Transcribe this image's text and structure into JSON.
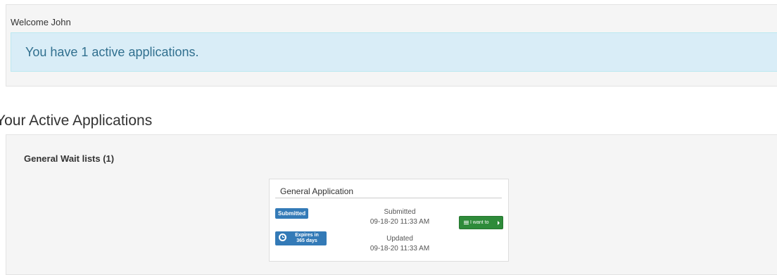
{
  "welcome": {
    "greeting": "Welcome John",
    "alert_message": "You have 1 active applications."
  },
  "active_applications": {
    "heading": "Your Active Applications",
    "group_title": "General Wait lists (1)",
    "card": {
      "title": "General Application",
      "status_badge": "Submitted",
      "expires_line1": "Expires in",
      "expires_line2": "365 days",
      "submitted_label": "Submitted",
      "submitted_date": "09-18-20 11:33 AM",
      "updated_label": "Updated",
      "updated_date": "09-18-20 11:33 AM",
      "action_button": "I want to",
      "icons": {
        "expires": "clock-icon",
        "button_left": "list-icon",
        "button_right": "caret-right-icon"
      }
    }
  },
  "colors": {
    "alert_bg": "#d9edf7",
    "alert_text": "#31708f",
    "badge_blue": "#337ab7",
    "button_green": "#2e8b3a",
    "panel_bg": "#f5f5f5"
  }
}
